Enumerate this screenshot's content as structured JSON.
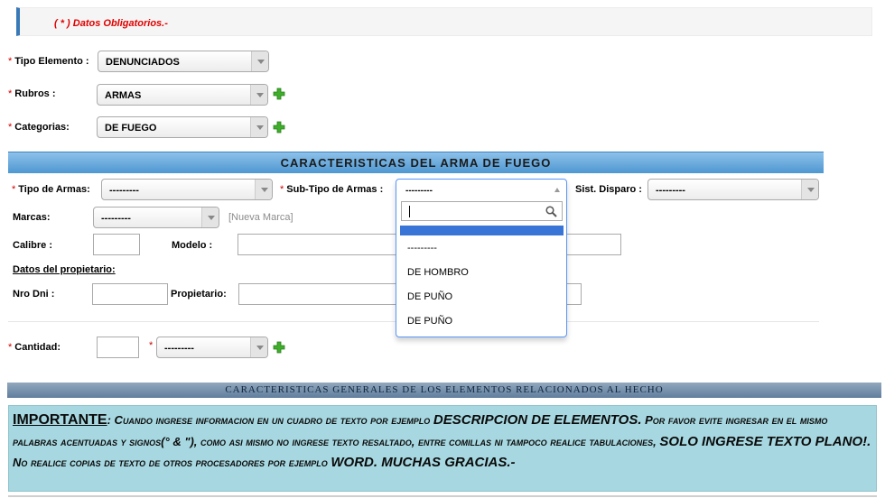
{
  "notice": "( * ) Datos Obligatorios.-",
  "required_mark": "*",
  "form": {
    "tipo_elemento": {
      "label": "Tipo Elemento :",
      "value": "DENUNCIADOS"
    },
    "rubros": {
      "label": "Rubros :",
      "value": "ARMAS"
    },
    "categorias": {
      "label": "Categorias:",
      "value": "DE FUEGO"
    }
  },
  "section_title": "CARACTERISTICAS DEL ARMA DE FUEGO",
  "arma": {
    "tipo_armas": {
      "label": "Tipo de Armas:",
      "value": "---------"
    },
    "subtipo": {
      "label": "Sub-Tipo de Armas :",
      "value": "---------"
    },
    "sist_disparo": {
      "label": "Sist. Disparo :",
      "value": "---------"
    },
    "marcas": {
      "label": "Marcas:",
      "value": "---------",
      "link": "[Nueva Marca]"
    },
    "calibre_label": "Calibre :",
    "modelo_label": "Modelo :",
    "propietario_heading": "Datos del propietario:",
    "nro_dni_label": "Nro Dni :",
    "propietario_label": "Propietario:"
  },
  "dropdown": {
    "search_value": "",
    "options": [
      "---------",
      "DE HOMBRO",
      "DE PUÑO",
      "DE PUÑO"
    ]
  },
  "cantidad": {
    "label": "Cantidad:",
    "unit_value": "---------"
  },
  "general_title": "CARACTERISTICAS GENERALES DE LOS ELEMENTOS RELACIONADOS AL HECHO",
  "important": {
    "heading": "IMPORTANTE",
    "colon": ":",
    "p1": " Cuando ingrese informacion en un cuadro de texto por ejemplo ",
    "b1": "DESCRIPCION DE ELEMENTOS.",
    "p2": " Por favor evite ingresar en el mismo palabras acentuadas y signos(° & \"), como asi mismo no ingrese texto resaltado, entre comillas ni tampoco realice tabulaciones, ",
    "b2": "SOLO INGRESE TEXTO PLANO!.",
    "p3": " No realice copias de texto de otros procesadores por ejemplo ",
    "b3": "WORD. MUCHAS GRACIAS.-"
  },
  "colors": {
    "accent": "#4e97d1",
    "required": "#d00000",
    "important_bg": "#a7d8e1",
    "plus_icon": "#3fae2a"
  }
}
